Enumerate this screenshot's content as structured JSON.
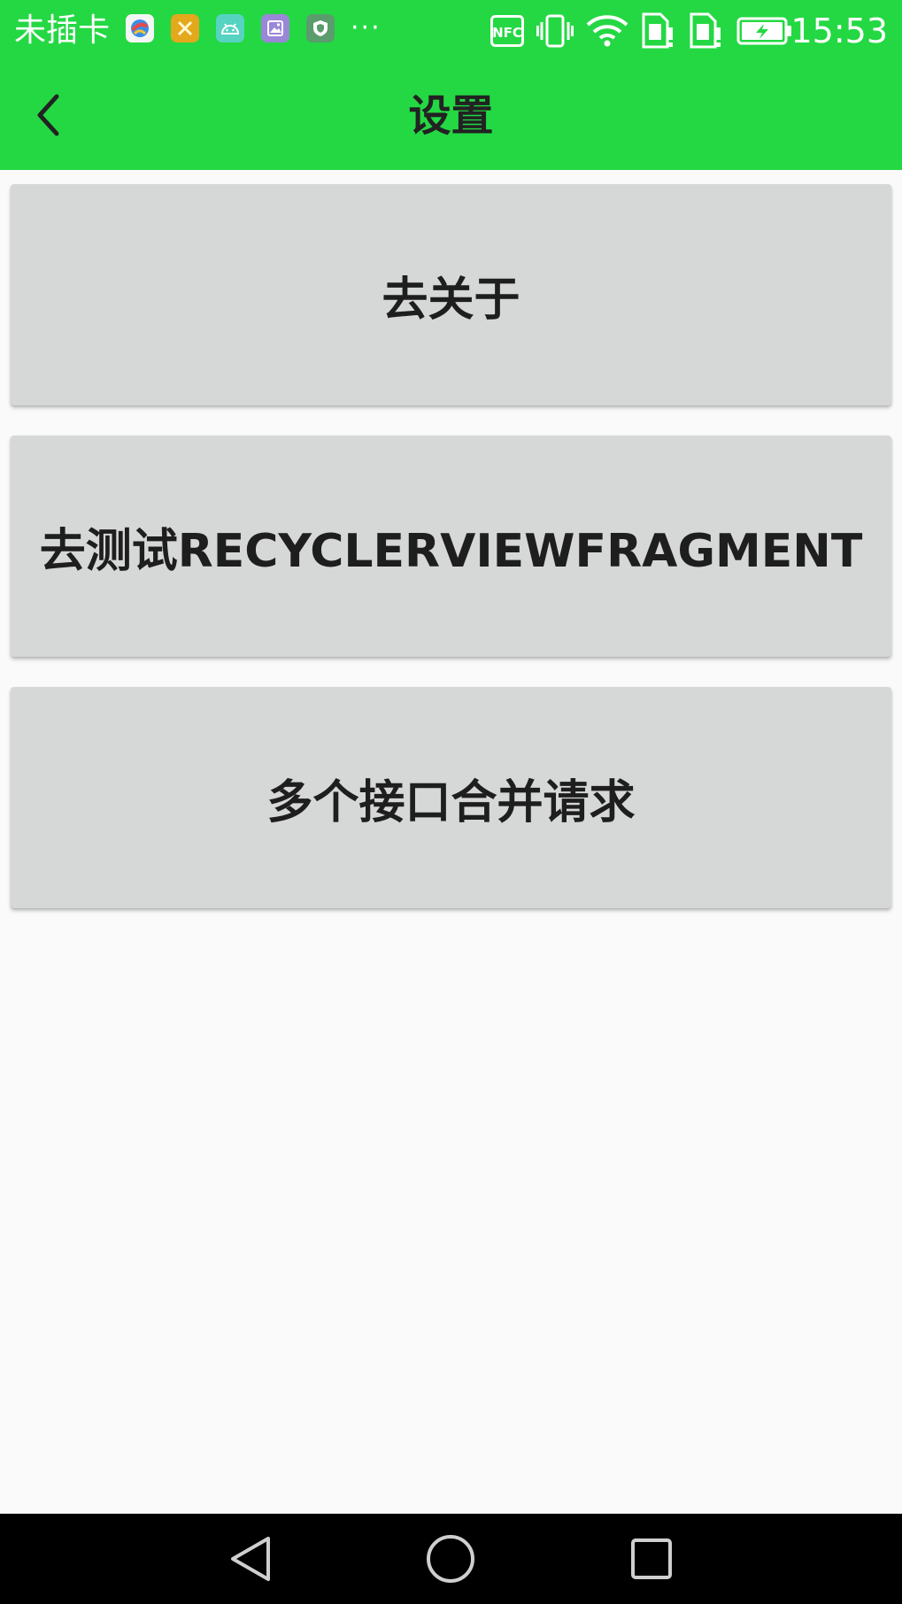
{
  "status_bar": {
    "carrier": "未插卡",
    "more": "···",
    "time": "15:53",
    "notification_icons": [
      {
        "name": "app-notification-icon-1",
        "color": "#f4f6f4"
      },
      {
        "name": "app-notification-icon-2",
        "color": "#e3a81c"
      },
      {
        "name": "android-notification-icon",
        "color": "#56d3c1"
      },
      {
        "name": "gallery-notification-icon",
        "color": "#9b87d8"
      },
      {
        "name": "shield-notification-icon",
        "color": "#5a9c6c"
      }
    ],
    "system_icons": [
      "nfc-icon",
      "vibrate-icon",
      "wifi-icon",
      "sim1-icon",
      "sim2-icon",
      "battery-charging-icon"
    ],
    "nfc_label": "NFC"
  },
  "app_bar": {
    "title": "设置",
    "back_icon": "chevron-left-icon"
  },
  "buttons": [
    {
      "label": "去关于"
    },
    {
      "label": "去测试RECYCLERVIEWFRAGMENT"
    },
    {
      "label": "多个接口合并请求"
    }
  ],
  "nav_bar": {
    "icons": [
      "back-triangle-icon",
      "home-circle-icon",
      "recents-square-icon"
    ]
  },
  "colors": {
    "primary": "#24d843",
    "button_bg": "#d6d7d7",
    "page_bg": "#fafafa",
    "nav_bg": "#000000"
  }
}
